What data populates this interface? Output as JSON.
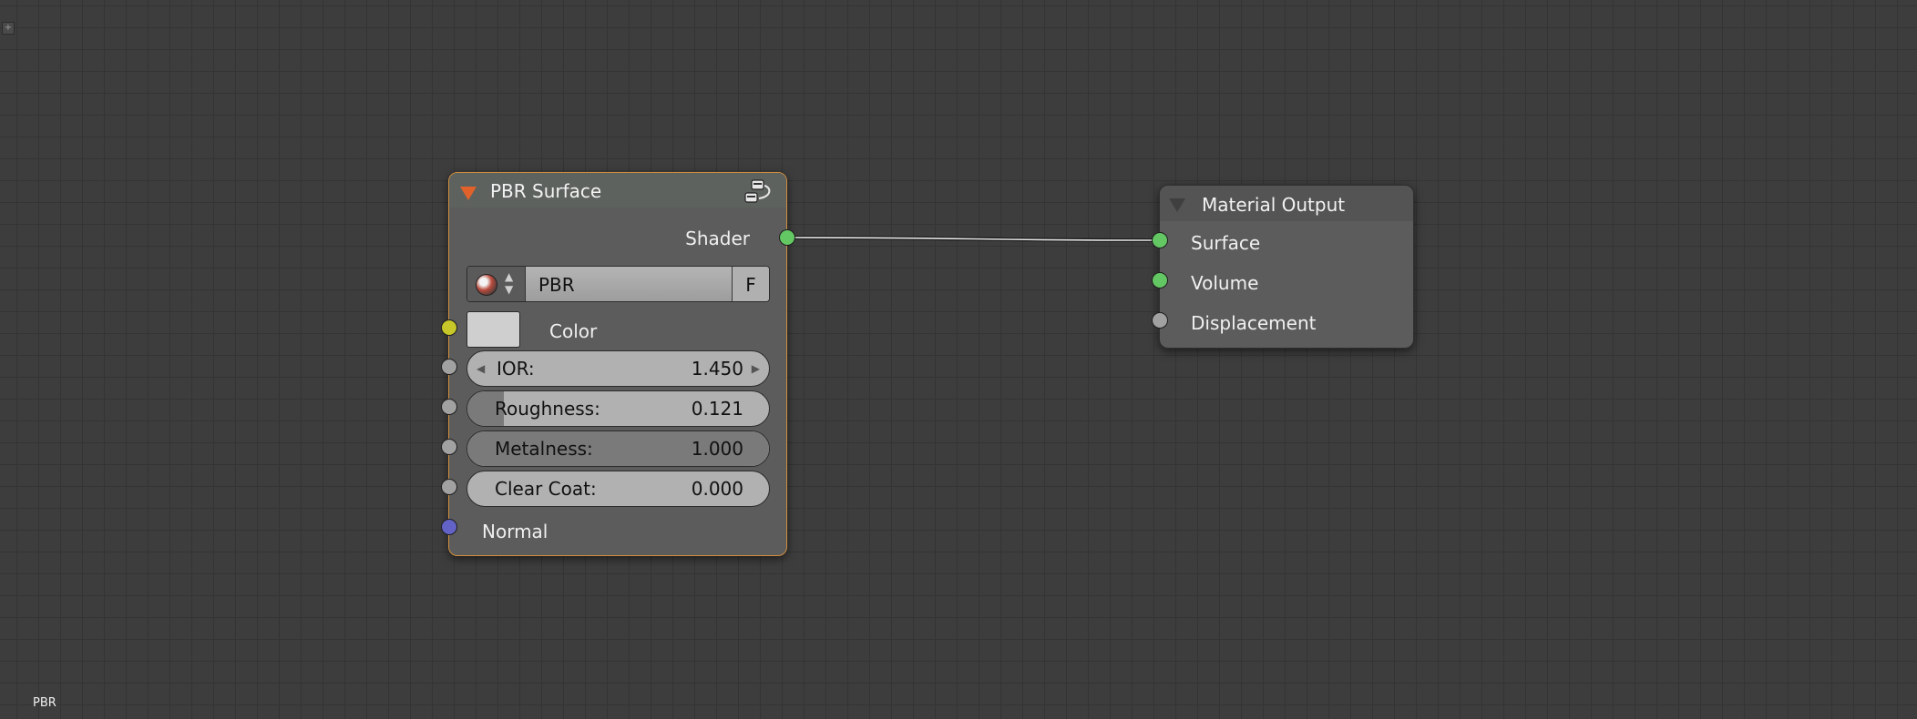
{
  "canvas": {
    "bottom_label": "PBR"
  },
  "pbr_node": {
    "title": "PBR Surface",
    "output": "Shader",
    "selector": {
      "name": "PBR",
      "fake_user": "F"
    },
    "color_label": "Color",
    "inputs": [
      {
        "label": "IOR:",
        "value": "1.450",
        "fill": 0
      },
      {
        "label": "Roughness:",
        "value": "0.121",
        "fill": 0.121
      },
      {
        "label": "Metalness:",
        "value": "1.000",
        "fill": 1.0
      },
      {
        "label": "Clear Coat:",
        "value": "0.000",
        "fill": 0.0
      }
    ],
    "normal_label": "Normal"
  },
  "output_node": {
    "title": "Material Output",
    "inputs": [
      "Surface",
      "Volume",
      "Displacement"
    ]
  },
  "colors": {
    "shader_socket": "#63c763",
    "color_socket": "#c7c729",
    "value_socket": "#a1a1a1",
    "vector_socket": "#6363c7",
    "selected_border": "#d08e3d"
  }
}
